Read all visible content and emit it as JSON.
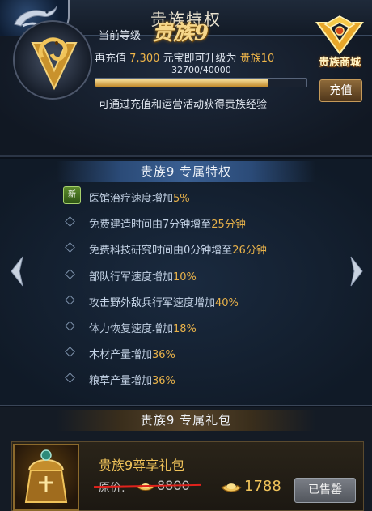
{
  "header": {
    "title": "贵族特权"
  },
  "status": {
    "current_level_label": "当前等级",
    "current_level_value": "贵族9",
    "recharge_prefix": "再充值",
    "recharge_amount": "7,300",
    "recharge_middle": "元宝即可升级为",
    "next_level": "贵族10",
    "progress_text": "32700/40000",
    "progress_fraction": 0.8175,
    "hint": "可通过充值和运营活动获得贵族经验",
    "mall_label": "贵族商城",
    "recharge_button": "充值"
  },
  "privileges": {
    "section_title": "贵族9  专属特权",
    "new_badge": "新",
    "items": [
      {
        "text": "医馆治疗速度增加",
        "highlight": "5%"
      },
      {
        "text": "免费建造时间由7分钟增至",
        "highlight": "25分钟"
      },
      {
        "text": "免费科技研究时间由0分钟增至",
        "highlight": "26分钟"
      },
      {
        "text": "部队行军速度增加",
        "highlight": "10%"
      },
      {
        "text": "攻击野外敌兵行军速度增加",
        "highlight": "40%"
      },
      {
        "text": "体力恢复速度增加",
        "highlight": "18%"
      },
      {
        "text": "木材产量增加",
        "highlight": "36%"
      },
      {
        "text": "粮草产量增加",
        "highlight": "36%"
      }
    ]
  },
  "gift": {
    "section_title": "贵族9  专属礼包",
    "name": "贵族9尊享礼包",
    "original_label": "原价:",
    "original_price": "8800",
    "price": "1788",
    "sold_button": "已售罄"
  },
  "colors": {
    "accent_gold": "#f0b64a",
    "text_blue": "#c4d3e6",
    "strike_red": "#e0221c"
  }
}
